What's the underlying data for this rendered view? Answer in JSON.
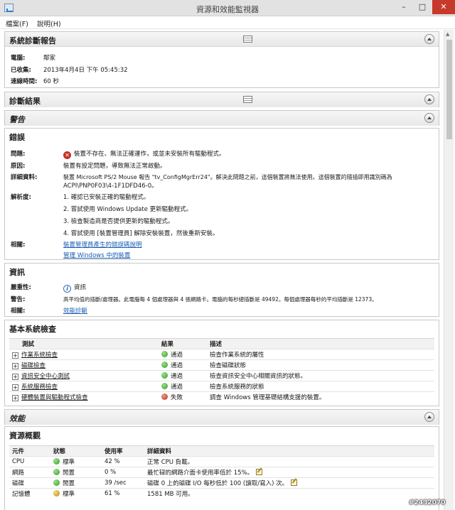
{
  "window": {
    "title": "資源和效能監視器",
    "minimize": "–",
    "maximize": "□",
    "close": "✕"
  },
  "menu": {
    "file": "檔案(F)",
    "help": "說明(H)"
  },
  "report": {
    "title": "系統診斷報告",
    "computer_label": "電腦:",
    "computer": "鄰家",
    "collected_label": "已收集:",
    "collected": "2013年4月4日 下午 05:45:32",
    "duration_label": "速線時間:",
    "duration": "60 秒"
  },
  "results": {
    "title": "診斷結果"
  },
  "warnings": {
    "title": "警告"
  },
  "error": {
    "title": "錯誤",
    "problem_label": "問題:",
    "problem": "裝置不存在、無法正確運作，或並未安裝所有驅動程式。",
    "cause_label": "原因:",
    "cause": "裝置有設定問題，導致無法正常啟動。",
    "details_label": "詳細資料:",
    "details_line1": "裝置 Microsoft PS/2 Mouse 報告 \"tv_ConfigMgrErr24\"。解決此問題之前，這個裝置將無法使用。這個裝置的隨插即用識別碼為",
    "details_line2": "ACPI\\PNP0F03\\4-1F1DFD46-0。",
    "resolution_label": "解析度:",
    "resolution": [
      "1. 確認已安裝正確的驅動程式。",
      "2. 嘗試使用 Windows Update 更新驅動程式。",
      "3. 檢查製造商是否提供更新的驅動程式。",
      "4. 嘗試使用 [裝置管理員] 解除安裝裝置，然後重新安裝。"
    ],
    "related_label": "相關:",
    "related_link1": "裝置管理員產生的錯誤碼說明",
    "related_link2": "管理 Windows 中的裝置"
  },
  "info": {
    "title": "資訊",
    "severity_label": "嚴重性:",
    "severity": "資訊",
    "warning_label": "警告:",
    "warning": "高平均值的插斷/處理器。此電腦每 4 個處理器與 4 張網路卡。電腦的每秒總插斷是 49492。每個處理器每秒的平均插斷是 12373。",
    "related_label": "相關:",
    "related_link": "效能診斷"
  },
  "basic_checks": {
    "title": "基本系統檢查",
    "columns": [
      "測試",
      "結果",
      "描述"
    ],
    "rows": [
      {
        "test": "作業系統檢查",
        "result": "通過",
        "status": "pass",
        "desc": "檢查作業系統的屬性"
      },
      {
        "test": "磁碟檢查",
        "result": "通過",
        "status": "pass",
        "desc": "檢查磁碟狀態"
      },
      {
        "test": "資訊安全中心測試",
        "result": "通過",
        "status": "pass",
        "desc": "檢查資訊安全中心相關資訊的狀態。"
      },
      {
        "test": "系統服務檢查",
        "result": "通過",
        "status": "pass",
        "desc": "檢查系統服務的狀態"
      },
      {
        "test": "硬體裝置與驅動程式檢查",
        "result": "失敗",
        "status": "fail",
        "desc": "調查 Windows 管理基礎結構支援的裝置。"
      }
    ]
  },
  "performance": {
    "title": "效能"
  },
  "resources": {
    "title": "資源概觀",
    "columns": [
      "元件",
      "狀態",
      "使用率",
      "詳細資料"
    ],
    "rows": [
      {
        "component": "CPU",
        "status": "標準",
        "color": "green",
        "usage": "42 %",
        "detail": "正常 CPU 負載。",
        "edit": false
      },
      {
        "component": "網路",
        "status": "閒置",
        "color": "green",
        "usage": "0 %",
        "detail": "最忙碌的網路介面卡使用率低於 15%。",
        "edit": true
      },
      {
        "component": "磁碟",
        "status": "閒置",
        "color": "green",
        "usage": "39 /sec",
        "detail": "磁碟 0 上的磁碟 I/O 每秒低於 100 (讀取/寫入) 次。",
        "edit": true
      },
      {
        "component": "記憶體",
        "status": "標準",
        "color": "yellow",
        "usage": "61 %",
        "detail": "1581 MB 可用。",
        "edit": false
      }
    ]
  },
  "watermark": "#2432070"
}
